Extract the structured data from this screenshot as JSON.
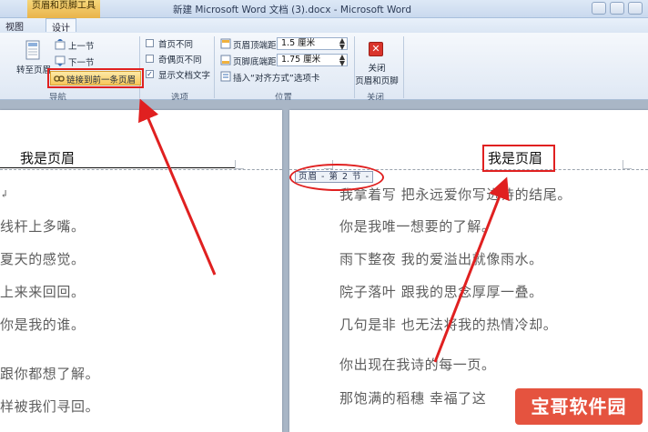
{
  "window": {
    "title": "新建 Microsoft Word 文档 (3).docx - Microsoft Word",
    "context_tab_group": "页眉和页脚工具"
  },
  "tabs": {
    "view": "视图",
    "design": "设计"
  },
  "ribbon": {
    "navigation": {
      "goto_header": "转至页眉",
      "prev_section": "上一节",
      "next_section": "下一节",
      "link_previous": "链接到前一条页眉",
      "group_label": "导航"
    },
    "options": {
      "different_first_page": "首页不同",
      "different_odd_even": "奇偶页不同",
      "show_document_text": "显示文档文字",
      "show_document_text_checked": true,
      "group_label": "选项"
    },
    "position": {
      "header_from_top_label": "页眉顶端距离:",
      "header_from_top_value": "1.5 厘米",
      "footer_from_bottom_label": "页脚底端距离:",
      "footer_from_bottom_value": "1.75 厘米",
      "insert_alignment_tab": "插入“对齐方式”选项卡",
      "group_label": "位置"
    },
    "close": {
      "button_line1": "关闭",
      "button_line2": "页眉和页脚",
      "group_label": "关闭"
    }
  },
  "document": {
    "left_page": {
      "header_text": "我是页眉",
      "lines": [
        "",
        "线杆上多嘴。",
        "夏天的感觉。",
        "上来来回回。",
        "你是我的谁。",
        "跟你都想了解。",
        "样被我们寻回。"
      ]
    },
    "right_page": {
      "header_text": "我是页眉",
      "header_tag": "页眉 - 第 2 节 -",
      "lines": [
        "我拿着写  把永远爱你写进诗的结尾。",
        "你是我唯一想要的了解。",
        "雨下整夜  我的爱溢出就像雨水。",
        "院子落叶  跟我的思念厚厚一叠。",
        "几句是非  也无法将我的热情冷却。",
        "你出现在我诗的每一页。",
        "那饱满的稻穗  幸福了这"
      ]
    }
  },
  "watermark": {
    "text": "宝哥软件园"
  },
  "colors": {
    "annotation": "#e02020",
    "ribbon_accent": "#f7c75a",
    "watermark_bg": "#e5533f"
  }
}
